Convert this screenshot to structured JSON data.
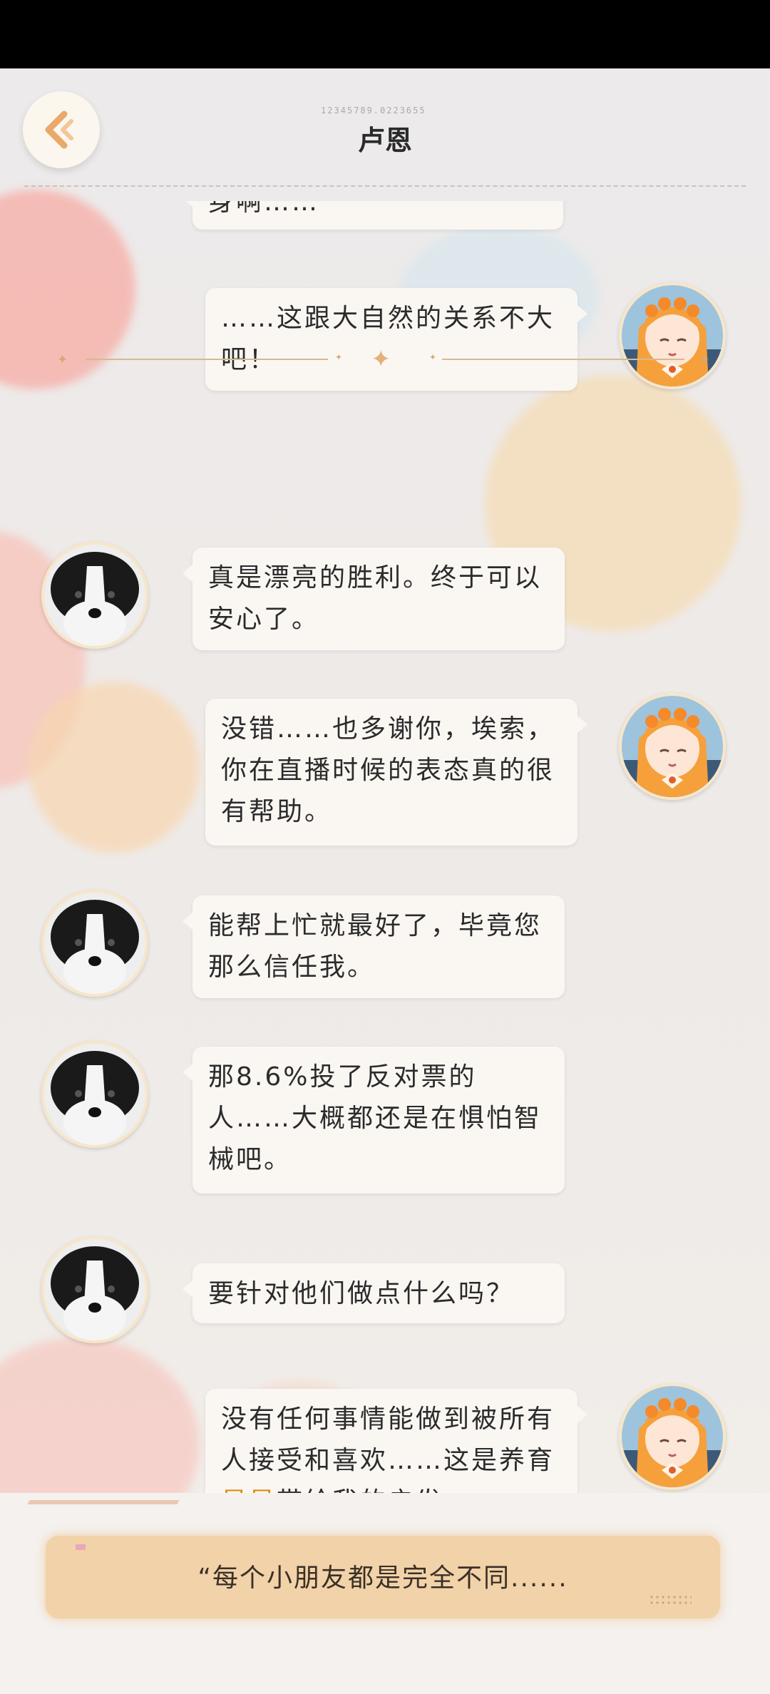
{
  "header": {
    "title": "卢恩",
    "code": "12345789.0223655"
  },
  "messages": [
    {
      "side": "left",
      "text": "身啊……"
    },
    {
      "side": "right",
      "text": "……这跟大自然的关系不大吧！"
    },
    {
      "side": "left",
      "text": "真是漂亮的胜利。终于可以安心了。"
    },
    {
      "side": "right",
      "text": "没错……也多谢你，埃索，你在直播时候的表态真的很有帮助。"
    },
    {
      "side": "left",
      "text": "能帮上忙就最好了，毕竟您那么信任我。"
    },
    {
      "side": "left",
      "text": "那8.6%投了反对票的人……大概都还是在惧怕智械吧。"
    },
    {
      "side": "left",
      "text": "要针对他们做点什么吗？"
    },
    {
      "side": "right",
      "text_before": "没有任何事情能做到被所有人接受和喜欢……这是养育",
      "highlight": "星星",
      "text_after": "带给我的启发。"
    }
  ],
  "reply": {
    "option_text": "“每个小朋友都是完全不同......"
  },
  "colors": {
    "accent": "#e08a12",
    "bubble": "#faf7f3",
    "reply_bg": "#f2d2a8"
  }
}
